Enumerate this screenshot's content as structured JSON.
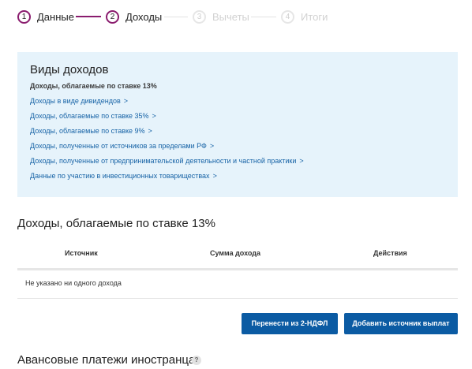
{
  "stepper": {
    "steps": [
      {
        "number": "1",
        "label": "Данные",
        "state": "done"
      },
      {
        "number": "2",
        "label": "Доходы",
        "state": "active"
      },
      {
        "number": "3",
        "label": "Вычеты",
        "state": "inactive"
      },
      {
        "number": "4",
        "label": "Итоги",
        "state": "inactive"
      }
    ]
  },
  "income_types": {
    "title": "Виды доходов",
    "subtitle": "Доходы, облагаемые по ставке 13%",
    "chevron": ">",
    "links": [
      "Доходы в виде дивидендов",
      "Доходы, облагаемые по ставке 35%",
      "Доходы, облагаемые по ставке 9%",
      "Доходы, полученные от источников за пределами РФ",
      "Доходы, полученные от предпринимательской деятельности и частной практики",
      "Данные по участию в инвестиционных товариществах"
    ]
  },
  "income_section": {
    "title": "Доходы, облагаемые по ставке 13%",
    "columns": [
      "Источник",
      "Сумма дохода",
      "Действия"
    ],
    "empty_message": "Не указано ни одного дохода"
  },
  "actions": {
    "transfer_label": "Перенести из 2-НДФЛ",
    "add_source_label": "Добавить источник выплат"
  },
  "advance_section": {
    "title": "Авансовые платежи иностранца",
    "help_glyph": "?"
  },
  "colors": {
    "accent": "#8a1c6e",
    "button": "#0b5ba3",
    "link": "#1763a6",
    "info_box": "#e6f3fb"
  }
}
